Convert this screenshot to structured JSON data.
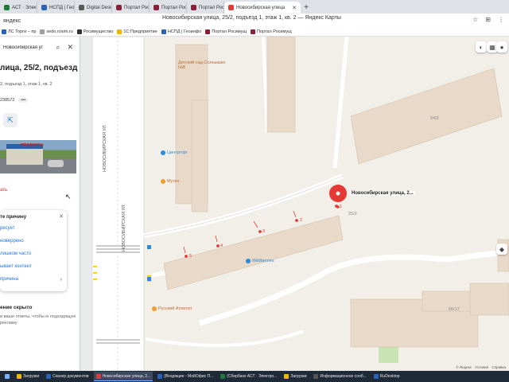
{
  "browser": {
    "tabs": [
      {
        "label": "АСТ · Электро",
        "color": "#1f7a3a"
      },
      {
        "label": "НСПД | Геоинформаци",
        "color": "#2a62b8"
      },
      {
        "label": "Digital Design Web Client",
        "color": "#5a5a5a"
      },
      {
        "label": "Портал Росимущества",
        "color": "#8c1f38"
      },
      {
        "label": "Портал Росимущества",
        "color": "#8c1f38"
      },
      {
        "label": "Портал Росимущества",
        "color": "#8c1f38"
      }
    ],
    "active_tab": {
      "label": "Новосибирская улица",
      "color": "#e53935"
    },
    "new_tab": "+",
    "address": "яндекс",
    "page_title": "Новосибирская улица, 25/2, подъезд 1, этаж 1, кв. 2 — Яндекс Карты",
    "bookmarks": [
      {
        "label": "ЛС Торги – пр",
        "color": "#2a62b8"
      },
      {
        "label": "sedo.rosim.ru",
        "color": "#9e9e9e"
      },
      {
        "label": "Росимущество",
        "color": "#333333"
      },
      {
        "label": "1С:Предприятие",
        "color": "#f2b600"
      },
      {
        "label": "НСПД | Геоинфо",
        "color": "#2a62b8"
      },
      {
        "label": "Портал Росимущ",
        "color": "#8c1f38"
      },
      {
        "label": "Портал Росимущ",
        "color": "#8c1f38"
      }
    ]
  },
  "panel": {
    "search_text": "Новосибирская ул., д. 25/",
    "title": "лица, 25/2, подъезд",
    "subtitle": "2, подъезд 1, этаж 1, кв. 2",
    "coords": "238573",
    "more": "•••",
    "photo_sign": "ПРОДУКТЫ",
    "report_link": "ать",
    "problem": {
      "title": "те причину",
      "options": [
        "ресует",
        "новеррено",
        "лишком часто",
        "ывает контент",
        "причина"
      ]
    },
    "hidden_title": "ение скрыто",
    "hidden_text": "и ваши ответы, чтобы ю подходящую рекламу"
  },
  "map": {
    "streets": [
      "НОВОСИБИРСКАЯ УЛ.",
      "НОВОСИБИРСКАЯ УЛ."
    ],
    "pois": [
      {
        "name": "Детский сад Солнышко №8"
      },
      {
        "name": "Центргорг"
      },
      {
        "name": "Мутко"
      },
      {
        "name": "Wildberries"
      },
      {
        "name": "Русский Аппетит"
      }
    ],
    "buildings": [
      "54/2",
      "25/2",
      "56/17"
    ],
    "entrances": [
      "1",
      "2",
      "3",
      "4",
      "5"
    ],
    "pin_label": "Новосибирская улица, 2...",
    "copyright": [
      "© Яндекс",
      "Условия",
      "Справка"
    ],
    "colors": {
      "building": "#e8d9c8",
      "road": "#ffffff",
      "pin": "#e53935",
      "green": "#c9e4b4"
    }
  },
  "taskbar": [
    {
      "label": "Загрузки",
      "color": "#f2b600",
      "active": false
    },
    {
      "label": "Сканер документов",
      "color": "#2a62b8",
      "active": false
    },
    {
      "label": "Новосибирская улица, 2...",
      "color": "#e53935",
      "active": true
    },
    {
      "label": "(Входящие - МойОфис П...",
      "color": "#2a62b8",
      "active": false
    },
    {
      "label": "(Сбербанк АСТ · Электро...",
      "color": "#1f7a3a",
      "active": false
    },
    {
      "label": "Загрузки",
      "color": "#f2b600",
      "active": false
    },
    {
      "label": "Информационное сооб...",
      "color": "#555555",
      "active": false
    },
    {
      "label": "RuDesktop",
      "color": "#2a62b8",
      "active": false
    }
  ]
}
